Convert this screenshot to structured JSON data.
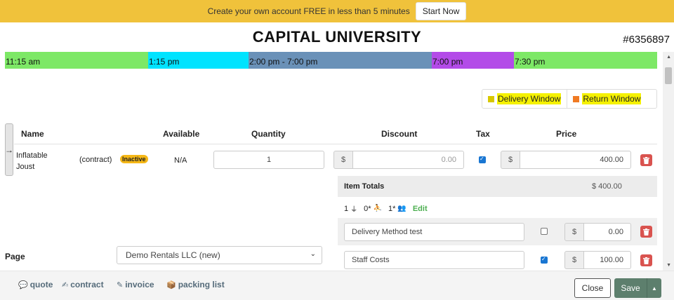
{
  "promo": {
    "text": "Create your own account FREE in less than 5 minutes",
    "button": "Start Now"
  },
  "header": {
    "title": "CAPITAL UNIVERSITY",
    "order_number": "#6356897"
  },
  "timeline": [
    {
      "label": "11:15 am",
      "color": "#7de866"
    },
    {
      "label": "1:15 pm",
      "color": "#00e3ff"
    },
    {
      "label": "2:00 pm - 7:00 pm",
      "color": "#6a91b8"
    },
    {
      "label": "7:00 pm",
      "color": "#b34be8"
    },
    {
      "label": "7:30 pm",
      "color": "#7de866"
    }
  ],
  "legend": {
    "delivery": "Delivery Window",
    "delivery_color": "#d8c800",
    "return": "Return Window",
    "return_color": "#f07a23"
  },
  "columns": {
    "name": "Name",
    "available": "Available",
    "quantity": "Quantity",
    "discount": "Discount",
    "tax": "Tax",
    "price": "Price"
  },
  "item": {
    "name": "Inflatable Joust",
    "type": "(contract)",
    "status": "Inactive",
    "available": "N/A",
    "quantity": "1",
    "discount_currency": "$",
    "discount": "0.00",
    "taxed": true,
    "price_currency": "$",
    "price": "400.00"
  },
  "item_totals": {
    "label": "Item Totals",
    "value": "$ 400.00"
  },
  "counts": {
    "power": "1",
    "staff": "0*",
    "crew": "1*",
    "edit": "Edit"
  },
  "fees": [
    {
      "name": "Delivery Method test",
      "taxed": false,
      "currency": "$",
      "amount": "0.00"
    },
    {
      "name": "Staff Costs",
      "taxed": true,
      "currency": "$",
      "amount": "100.00"
    }
  ],
  "page_field": {
    "label": "Page",
    "value": "Demo Rentals LLC (new)"
  },
  "footer": {
    "links": [
      "quote",
      "contract",
      "invoice",
      "packing list"
    ],
    "close": "Close",
    "save": "Save"
  }
}
